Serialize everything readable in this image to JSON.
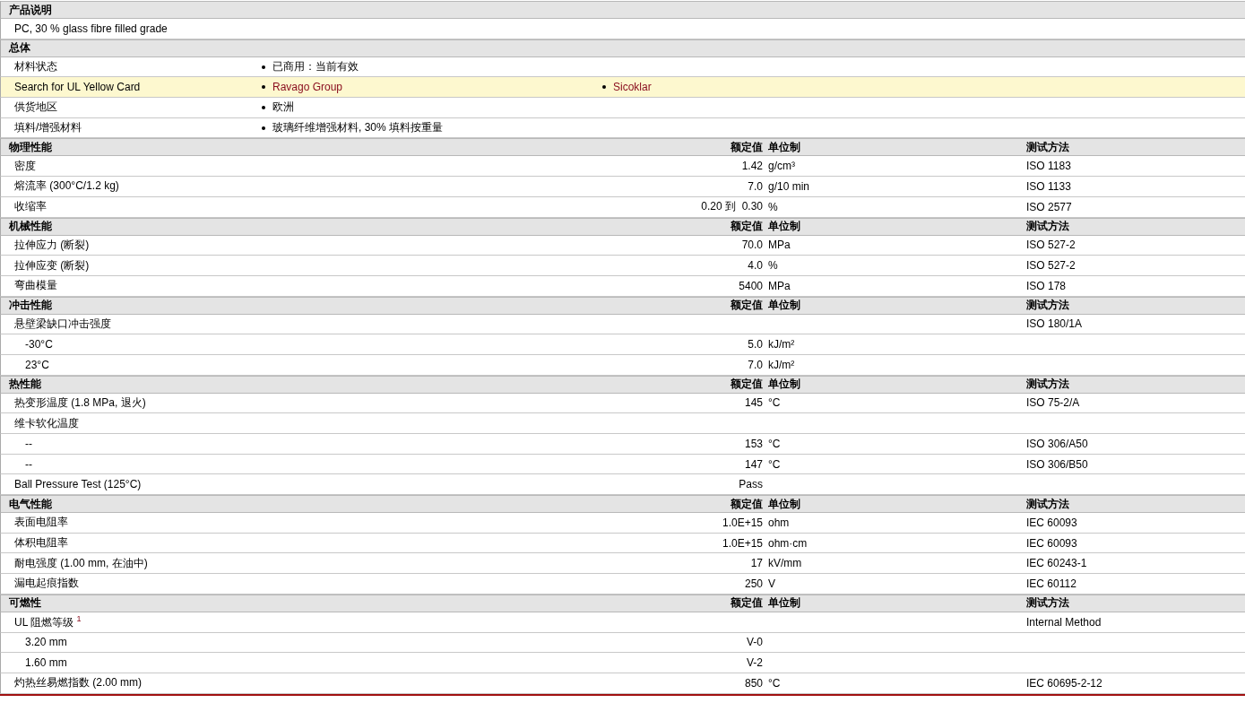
{
  "description": {
    "title": "产品说明",
    "text": "PC, 30 % glass fibre filled grade"
  },
  "general": {
    "title": "总体",
    "rows": [
      {
        "label": "材料状态",
        "highlighted": false,
        "values": [
          {
            "text": "已商用：当前有效",
            "link": false
          }
        ]
      },
      {
        "label": "Search for UL Yellow Card",
        "highlighted": true,
        "values": [
          {
            "text": "Ravago Group",
            "link": true
          },
          {
            "text": "Sicoklar",
            "link": true
          }
        ]
      },
      {
        "label": "供货地区",
        "highlighted": false,
        "values": [
          {
            "text": "欧洲",
            "link": false
          }
        ]
      },
      {
        "label": "填料/增强材料",
        "highlighted": false,
        "values": [
          {
            "text": "玻璃纤维增强材料, 30% 填料按重量",
            "link": false
          }
        ]
      }
    ]
  },
  "sections": [
    {
      "title": "物理性能",
      "value_header": "额定值",
      "unit_header": "单位制",
      "method_header": "测试方法",
      "rows": [
        {
          "label": "密度",
          "value": "1.42",
          "unit": "g/cm³",
          "method": "ISO 1183"
        },
        {
          "label": "熔流率 (300°C/1.2 kg)",
          "value": "7.0",
          "unit": "g/10 min",
          "method": "ISO 1133"
        },
        {
          "label": "收缩率",
          "value": "0.20 到  0.30",
          "unit": "%",
          "method": "ISO 2577"
        }
      ]
    },
    {
      "title": "机械性能",
      "value_header": "额定值",
      "unit_header": "单位制",
      "method_header": "测试方法",
      "rows": [
        {
          "label": "拉伸应力 (断裂)",
          "value": "70.0",
          "unit": "MPa",
          "method": "ISO 527-2"
        },
        {
          "label": "拉伸应变 (断裂)",
          "value": "4.0",
          "unit": "%",
          "method": "ISO 527-2"
        },
        {
          "label": "弯曲模量",
          "value": "5400",
          "unit": "MPa",
          "method": "ISO 178"
        }
      ]
    },
    {
      "title": "冲击性能",
      "value_header": "额定值",
      "unit_header": "单位制",
      "method_header": "测试方法",
      "rows": [
        {
          "label": "悬壁梁缺口冲击强度",
          "method": "ISO 180/1A",
          "children": [
            {
              "label": "-30°C",
              "value": "5.0",
              "unit": "kJ/m²"
            },
            {
              "label": "23°C",
              "value": "7.0",
              "unit": "kJ/m²"
            }
          ]
        }
      ]
    },
    {
      "title": "热性能",
      "value_header": "额定值",
      "unit_header": "单位制",
      "method_header": "测试方法",
      "rows": [
        {
          "label": "热变形温度 (1.8 MPa, 退火)",
          "value": "145",
          "unit": "°C",
          "method": "ISO 75-2/A"
        },
        {
          "label": "维卡软化温度",
          "children": [
            {
              "label": "--",
              "value": "153",
              "unit": "°C",
              "method": "ISO 306/A50"
            },
            {
              "label": "--",
              "value": "147",
              "unit": "°C",
              "method": "ISO 306/B50"
            }
          ]
        },
        {
          "label": "Ball Pressure Test (125°C)",
          "value": "Pass"
        }
      ]
    },
    {
      "title": "电气性能",
      "value_header": "额定值",
      "unit_header": "单位制",
      "method_header": "测试方法",
      "rows": [
        {
          "label": "表面电阻率",
          "value": "1.0E+15",
          "unit": "ohm",
          "method": "IEC 60093"
        },
        {
          "label": "体积电阻率",
          "value": "1.0E+15",
          "unit": "ohm·cm",
          "method": "IEC 60093"
        },
        {
          "label": "耐电强度 (1.00 mm, 在油中)",
          "value": "17",
          "unit": "kV/mm",
          "method": "IEC 60243-1"
        },
        {
          "label": "漏电起痕指数",
          "value": "250",
          "unit": "V",
          "method": "IEC 60112"
        }
      ]
    },
    {
      "title": "可燃性",
      "value_header": "额定值",
      "unit_header": "单位制",
      "method_header": "测试方法",
      "rows": [
        {
          "label": "UL 阻燃等级 $^{1}$",
          "method": "Internal Method",
          "children": [
            {
              "label": "3.20 mm",
              "value": "V-0"
            },
            {
              "label": "1.60 mm",
              "value": "V-2"
            }
          ]
        },
        {
          "label": "灼热丝易燃指数 (2.00 mm)",
          "value": "850",
          "unit": "°C",
          "method": "IEC 60695-2-12"
        }
      ]
    }
  ]
}
